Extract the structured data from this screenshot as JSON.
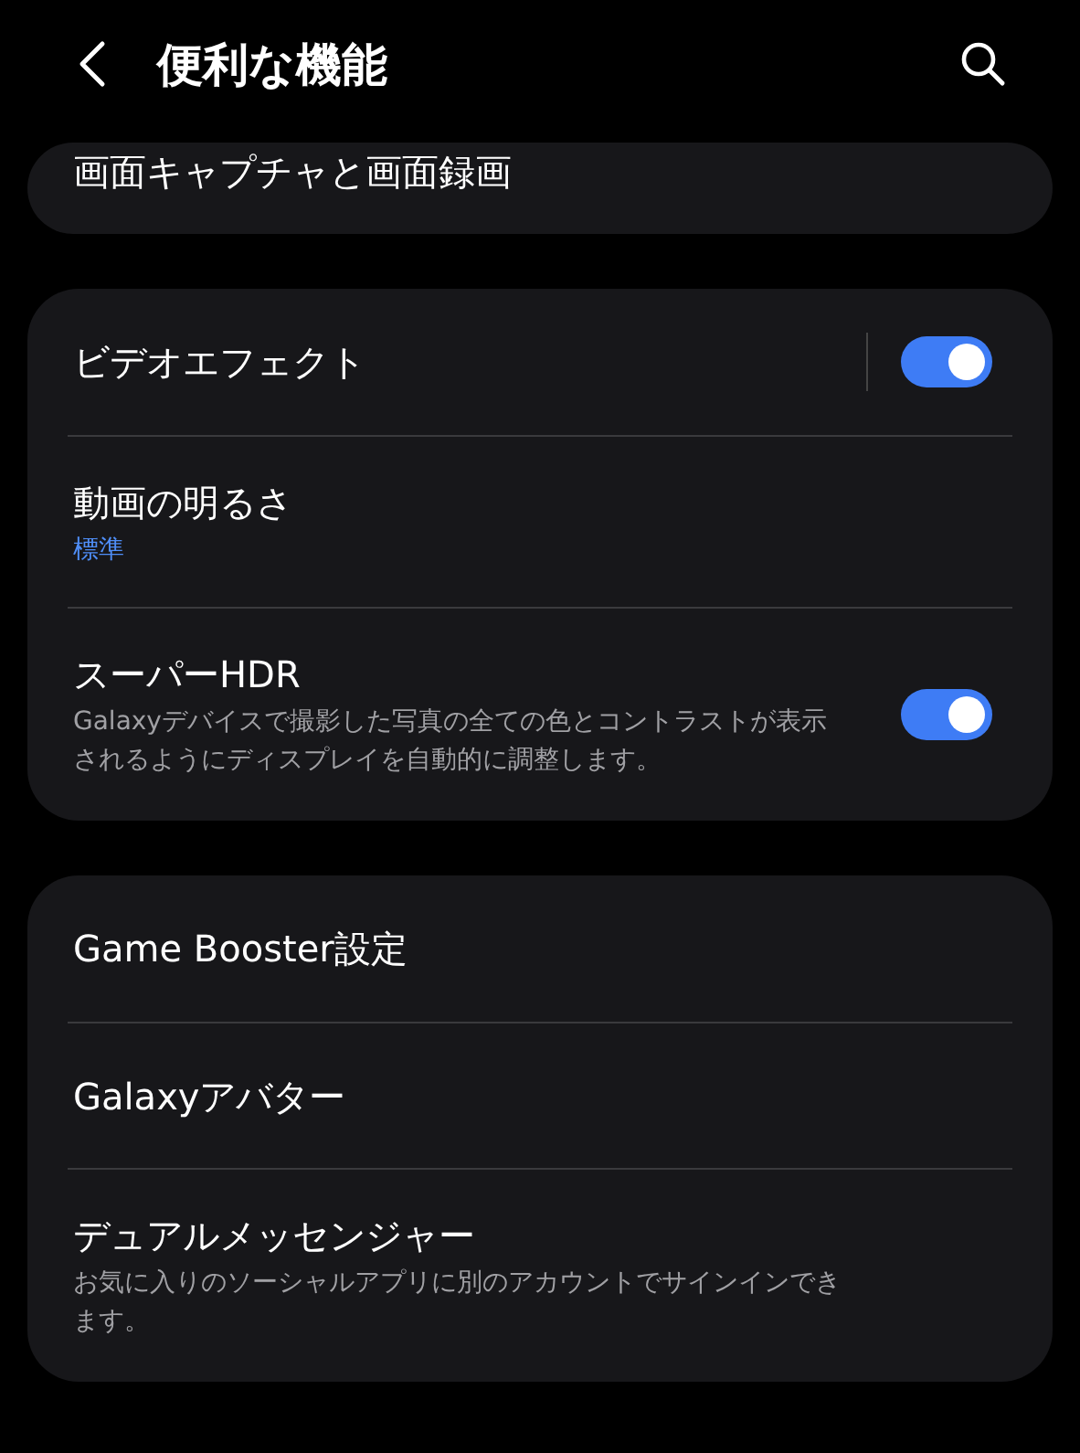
{
  "header": {
    "title": "便利な機能"
  },
  "cards": [
    {
      "items": [
        {
          "kind": "plain",
          "title": "画面キャプチャと画面録画"
        }
      ]
    },
    {
      "items": [
        {
          "kind": "split-toggle",
          "title": "ビデオエフェクト",
          "on": true
        },
        {
          "kind": "value",
          "title": "動画の明るさ",
          "value": "標準"
        },
        {
          "kind": "toggle",
          "title": "スーパーHDR",
          "description": "Galaxyデバイスで撮影した写真の全ての色とコントラストが表示されるようにディスプレイを自動的に調整します。",
          "on": true
        }
      ]
    },
    {
      "items": [
        {
          "kind": "plain",
          "title": "Game Booster設定"
        },
        {
          "kind": "plain",
          "title": "Galaxyアバター"
        },
        {
          "kind": "plain",
          "title": "デュアルメッセンジャー",
          "description": "お気に入りのソーシャルアプリに別のアカウントでサインインできます。"
        }
      ]
    }
  ]
}
